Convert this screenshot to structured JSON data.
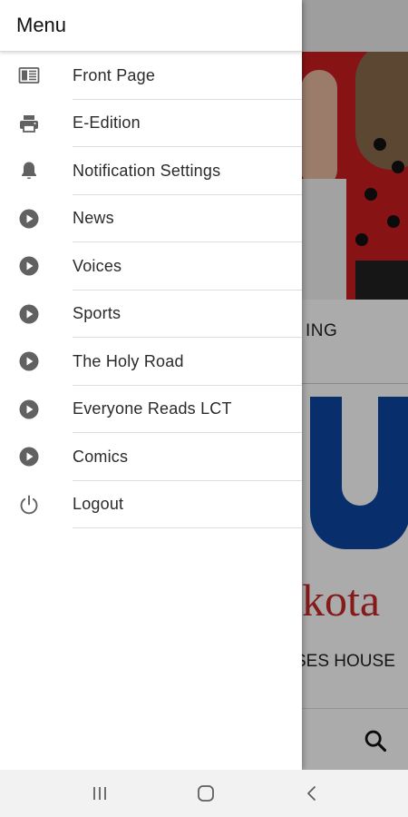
{
  "drawer": {
    "title": "Menu",
    "items": [
      {
        "label": "Front Page",
        "icon": "newspaper-icon"
      },
      {
        "label": "E-Edition",
        "icon": "printer-icon"
      },
      {
        "label": "Notification Settings",
        "icon": "bell-icon"
      },
      {
        "label": "News",
        "icon": "play-circle-icon"
      },
      {
        "label": "Voices",
        "icon": "play-circle-icon"
      },
      {
        "label": "Sports",
        "icon": "play-circle-icon"
      },
      {
        "label": "The Holy Road",
        "icon": "play-circle-icon"
      },
      {
        "label": "Everyone Reads LCT",
        "icon": "play-circle-icon"
      },
      {
        "label": "Comics",
        "icon": "play-circle-icon"
      },
      {
        "label": "Logout",
        "icon": "power-icon"
      }
    ]
  },
  "background": {
    "headline_fragment_1": "ING",
    "logo_text_fragment": "kota",
    "headline_fragment_2": "SES HOUSE"
  },
  "colors": {
    "icon_gray": "#616161",
    "logo_blue": "#0d47a1",
    "logo_red": "#c62828",
    "photo_red": "#c91d1f"
  },
  "navbar": {
    "buttons": [
      "recent-apps-icon",
      "home-icon",
      "back-icon"
    ]
  }
}
